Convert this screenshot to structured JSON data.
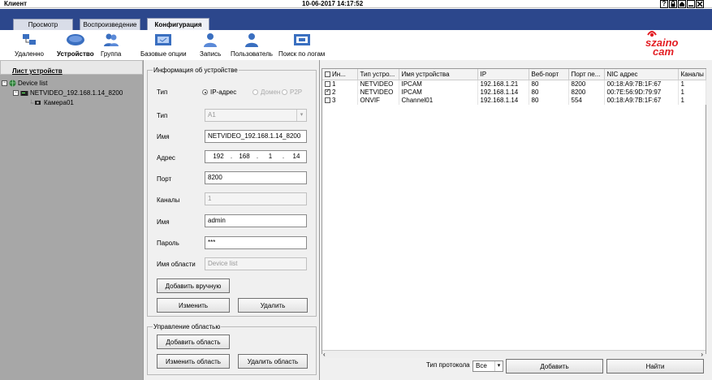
{
  "window": {
    "title": "Клиент",
    "datetime": "10-06-2017 14:17:52",
    "buttons": [
      "?",
      "B",
      "▭",
      "✕"
    ]
  },
  "tabs": [
    {
      "label": "Просмотр",
      "active": false
    },
    {
      "label": "Воспроизведение",
      "active": false
    },
    {
      "label": "Конфигурация",
      "active": true
    }
  ],
  "toolbar": {
    "items": [
      {
        "label": "Удаленно",
        "icon": "remote-icon"
      },
      {
        "label": "Устройство",
        "icon": "device-icon",
        "active": true
      },
      {
        "label": "Группа",
        "icon": "group-icon"
      },
      {
        "label": "Базовые опции",
        "icon": "basic-options-icon"
      },
      {
        "label": "Запись",
        "icon": "record-icon"
      },
      {
        "label": "Пользователь",
        "icon": "user-icon"
      },
      {
        "label": "Поиск по логам",
        "icon": "log-search-icon"
      }
    ]
  },
  "brand": {
    "logo_text": "szaino cam",
    "color": "#e31e24"
  },
  "sidebar": {
    "header": "Лист устройств",
    "tree": {
      "root": "Device list",
      "device": "NETVIDEO_192.168.1.14_8200",
      "camera": "Камера01"
    }
  },
  "device_info": {
    "group_title": "Информация об устройстве",
    "type_label": "Тип",
    "type_options": [
      {
        "label": "IP-адрес",
        "selected": true
      },
      {
        "label": "Домен",
        "selected": false
      },
      {
        "label": "P2P",
        "selected": false
      }
    ],
    "type2_label": "Тип",
    "type2_value": "A1",
    "name_label": "Имя",
    "name_value": "NETVIDEO_192.168.1.14_8200",
    "address_label": "Адрес",
    "address_octets": [
      "192",
      "168",
      "1",
      "14"
    ],
    "port_label": "Порт",
    "port_value": "8200",
    "channels_label": "Каналы",
    "channels_value": "1",
    "user_label": "Имя",
    "user_value": "admin",
    "password_label": "Пароль",
    "password_value": "***",
    "area_label": "Имя области",
    "area_value": "Device list",
    "add_manual_button": "Добавить вручную",
    "edit_button": "Изменить",
    "delete_button": "Удалить"
  },
  "area_mgmt": {
    "group_title": "Управление областью",
    "add_button": "Добавить область",
    "edit_button": "Изменить область",
    "delete_button": "Удалить область"
  },
  "device_table": {
    "columns": [
      "Ин...",
      "Тип устро...",
      "Имя устройства",
      "IP",
      "Веб-порт",
      "Порт пе...",
      "NIC адрес",
      "Каналы"
    ],
    "rows": [
      {
        "checked": false,
        "idx": "1",
        "type": "NETVIDEO",
        "name": "IPCAM",
        "ip": "192.168.1.21",
        "web_port": "80",
        "port": "8200",
        "nic": "00:18:A9:7B:1F:67",
        "channels": "1"
      },
      {
        "checked": true,
        "idx": "2",
        "type": "NETVIDEO",
        "name": "IPCAM",
        "ip": "192.168.1.14",
        "web_port": "80",
        "port": "8200",
        "nic": "00:7E:56:9D:79:97",
        "channels": "1"
      },
      {
        "checked": false,
        "idx": "3",
        "type": "ONVIF",
        "name": "Channel01",
        "ip": "192.168.1.14",
        "web_port": "80",
        "port": "554",
        "nic": "00:18:A9:7B:1F:67",
        "channels": "1"
      }
    ]
  },
  "bottom": {
    "protocol_label": "Тип протокола",
    "protocol_value": "Все",
    "add_button": "Добавить",
    "find_button": "Найти"
  }
}
